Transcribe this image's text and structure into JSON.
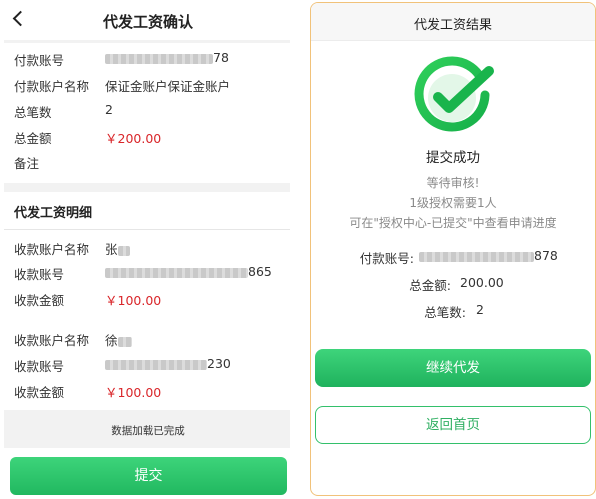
{
  "left": {
    "header": {
      "title": "代发工资确认"
    },
    "payer": {
      "account_label": "付款账号",
      "account_suffix": "78",
      "name_label": "付款账户名称",
      "name_value": "保证金账户保证金账户",
      "count_label": "总笔数",
      "count_value": "2",
      "total_label": "总金额",
      "total_value": "￥200.00",
      "remark_label": "备注"
    },
    "detail": {
      "title": "代发工资明细",
      "items": [
        {
          "name_label": "收款账户名称",
          "name_value": "张",
          "account_label": "收款账号",
          "account_suffix": "865",
          "amount_label": "收款金额",
          "amount_value": "￥100.00"
        },
        {
          "name_label": "收款账户名称",
          "name_value": "徐",
          "account_label": "收款账号",
          "account_suffix": "230",
          "amount_label": "收款金额",
          "amount_value": "￥100.00"
        }
      ]
    },
    "footer_note": "数据加载已完成",
    "submit_label": "提交"
  },
  "right": {
    "header": {
      "title": "代发工资结果"
    },
    "status": "提交成功",
    "sub_lines": [
      "等待审核!",
      "1级授权需要1人",
      "可在\"授权中心-已提交\"中查看申请进度"
    ],
    "info": {
      "account_label": "付款账号:",
      "account_suffix": "878",
      "total_label": "总金额:",
      "total_value": "200.00",
      "count_label": "总笔数:",
      "count_value": "2"
    },
    "continue_label": "继续代发",
    "home_label": "返回首页"
  },
  "colors": {
    "accent_green": "#21b860",
    "amount_red": "#d9262a",
    "panel_border": "#f1c27a"
  },
  "icons": [
    "back-arrow-icon",
    "success-check-icon"
  ]
}
